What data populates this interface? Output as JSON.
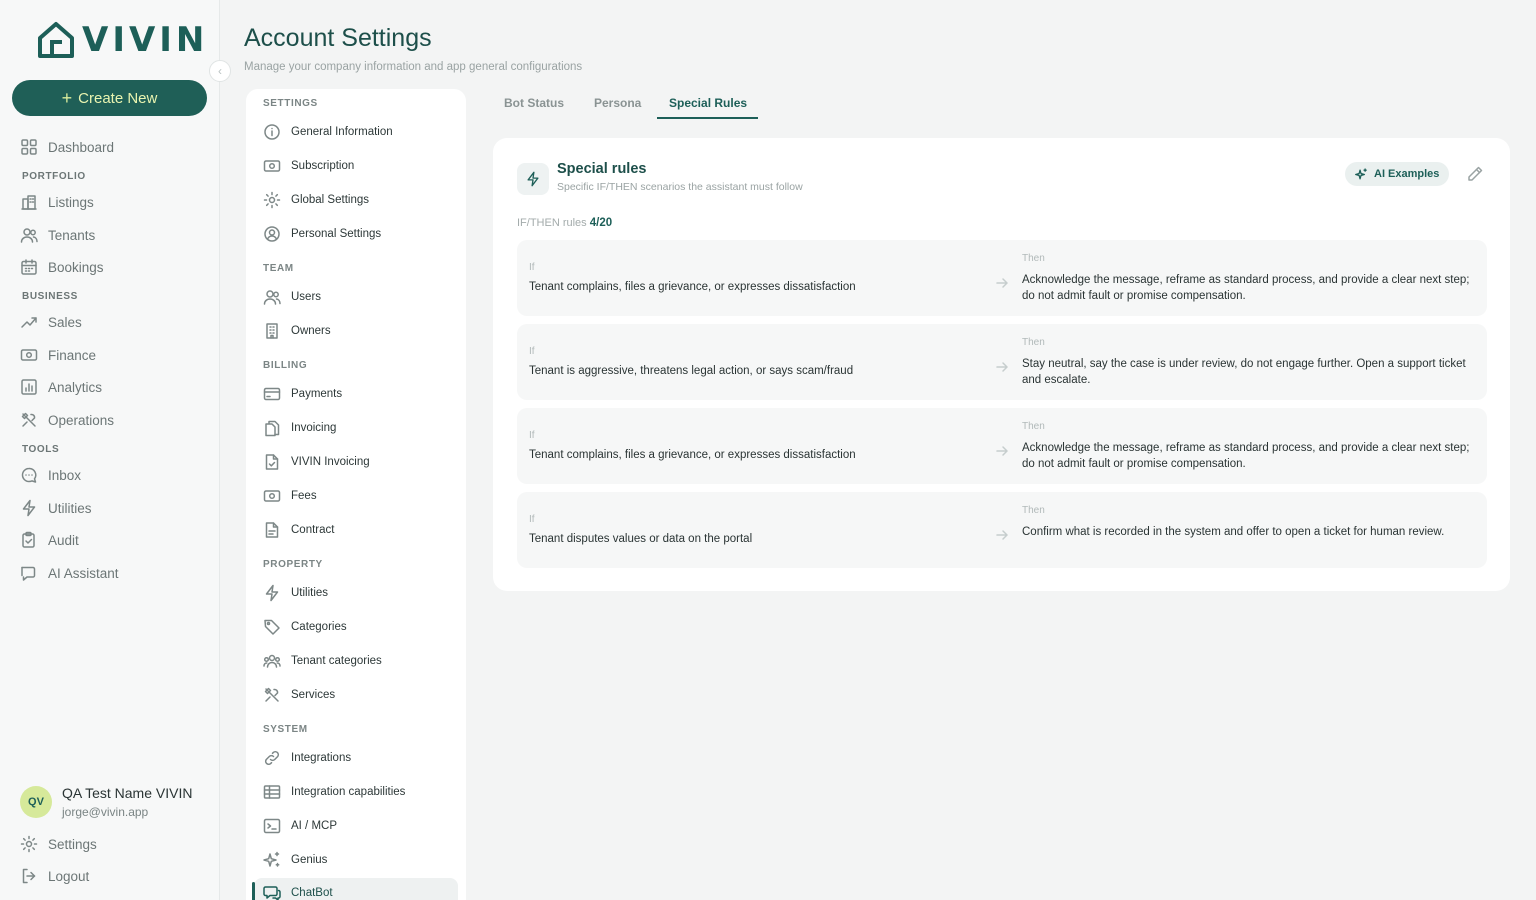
{
  "brand": {
    "name": "VIVIN"
  },
  "sidebar": {
    "create_label": "Create New",
    "items": {
      "dashboard": "Dashboard",
      "portfolio": "PORTFOLIO",
      "listings": "Listings",
      "tenants": "Tenants",
      "bookings": "Bookings",
      "business": "BUSINESS",
      "sales": "Sales",
      "finance": "Finance",
      "analytics": "Analytics",
      "operations": "Operations",
      "tools": "TOOLS",
      "inbox": "Inbox",
      "utilities": "Utilities",
      "audit": "Audit",
      "ai_assistant": "AI Assistant"
    },
    "user": {
      "initials": "QV",
      "name": "QA Test Name VIVIN",
      "email": "jorge@vivin.app"
    },
    "settings_label": "Settings",
    "logout_label": "Logout"
  },
  "header": {
    "title": "Account Settings",
    "subtitle": "Manage your company information and app general configurations"
  },
  "settings_nav": {
    "settings_section": "SETTINGS",
    "general_information": "General Information",
    "subscription": "Subscription",
    "global_settings": "Global Settings",
    "personal_settings": "Personal Settings",
    "team_section": "TEAM",
    "users": "Users",
    "owners": "Owners",
    "billing_section": "BILLING",
    "payments": "Payments",
    "invoicing": "Invoicing",
    "vivin_invoicing": "VIVIN Invoicing",
    "fees": "Fees",
    "contract": "Contract",
    "property_section": "PROPERTY",
    "utilities": "Utilities",
    "categories": "Categories",
    "tenant_categories": "Tenant categories",
    "services": "Services",
    "system_section": "SYSTEM",
    "integrations": "Integrations",
    "integration_capabilities": "Integration capabilities",
    "ai_mcp": "AI / MCP",
    "genius": "Genius",
    "chatbot": "ChatBot"
  },
  "tabs": {
    "bot_status": "Bot Status",
    "persona": "Persona",
    "special_rules": "Special Rules",
    "active": "special_rules"
  },
  "rules_card": {
    "title": "Special rules",
    "subtitle": "Specific IF/THEN scenarios the assistant must follow",
    "ai_examples_label": "AI Examples",
    "count_label": "IF/THEN rules",
    "count_value": "4/20",
    "if_label": "If",
    "then_label": "Then",
    "rules": [
      {
        "if": "Tenant complains, files a grievance, or expresses dissatisfaction",
        "then": "Acknowledge the message, reframe as standard process, and provide a clear next step; do not admit fault or promise compensation."
      },
      {
        "if": "Tenant is aggressive, threatens legal action, or says scam/fraud",
        "then": "Stay neutral, say the case is under review, do not engage further. Open a support ticket and escalate."
      },
      {
        "if": "Tenant complains, files a grievance, or expresses dissatisfaction",
        "then": "Acknowledge the message, reframe as standard process, and provide a clear next step; do not admit fault or promise compensation."
      },
      {
        "if": "Tenant disputes values or data on the portal",
        "then": "Confirm what is recorded in the system and offer to open a ticket for human review."
      }
    ]
  },
  "colors": {
    "brand": "#1d5f58",
    "accent": "#d6e99a",
    "background": "#f3f4f4"
  }
}
